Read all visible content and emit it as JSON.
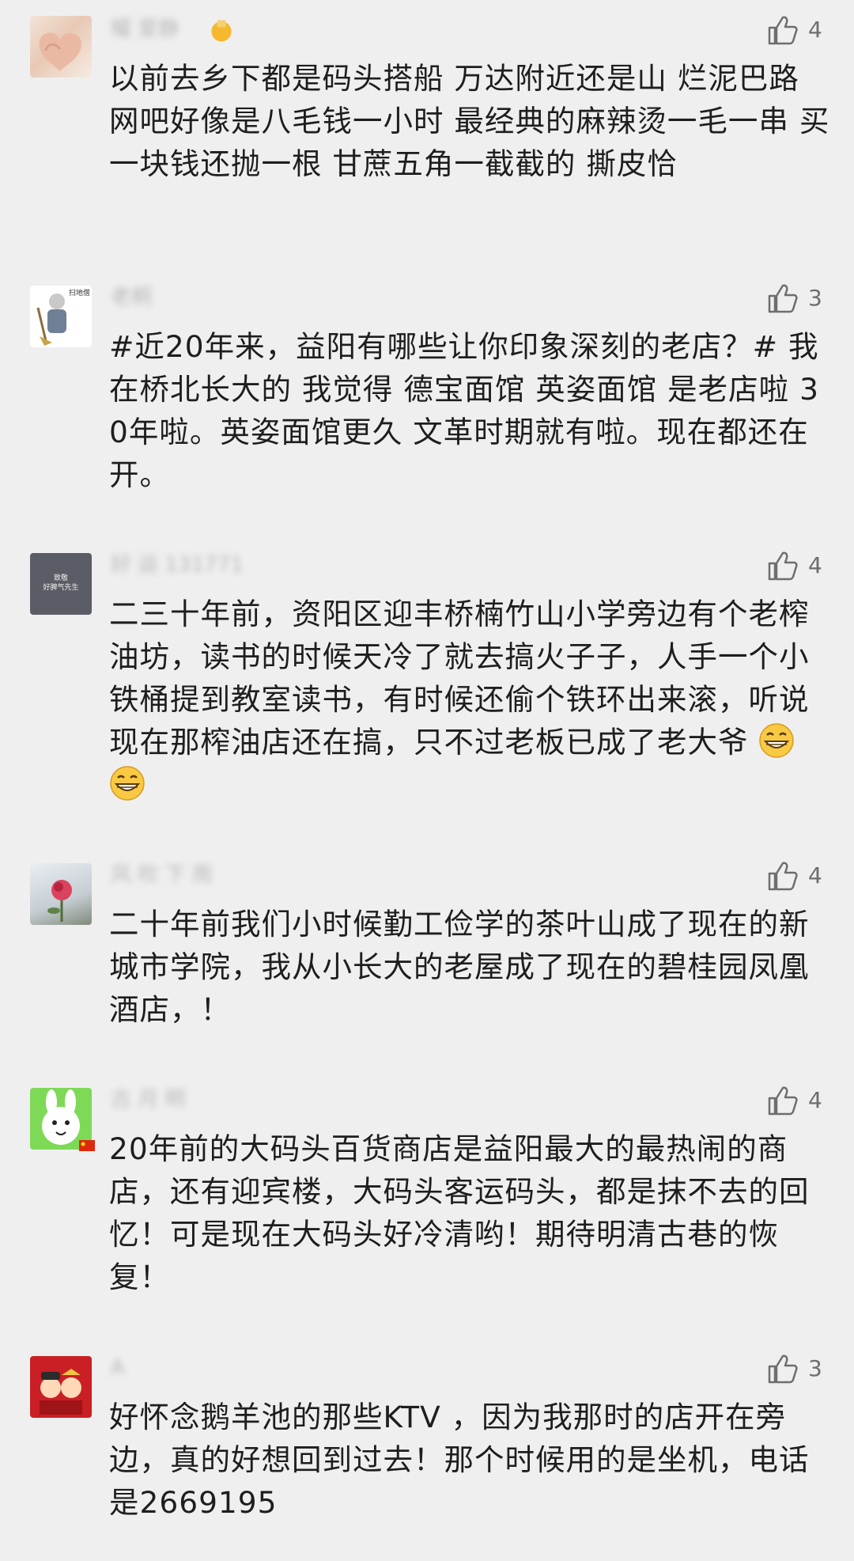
{
  "like_icon": "thumbs-up-outline-icon",
  "colors": {
    "background": "#efefef",
    "text": "#1e1e1e",
    "nickname": "#b9b9b9",
    "like": "#6e6e6e"
  },
  "comments": [
    {
      "nickname": "耀 爱静",
      "likes": "4",
      "text": "以前去乡下都是码头搭船  万达附近还是山  烂泥巴路  网吧好像是八毛钱一小时  最经典的麻辣烫一毛一串  买一块钱还抛一根   甘蔗五角一截截的 撕皮恰"
    },
    {
      "nickname": "老桐",
      "avatar_text": "扫地僧",
      "likes": "3",
      "text": "#近20年来，益阳有哪些让你印象深刻的老店？# 我在桥北长大的 我觉得 德宝面馆 英姿面馆 是老店啦 30年啦。英姿面馆更久 文革时期就有啦。现在都还在开。"
    },
    {
      "nickname": "好 运 131771",
      "avatar_text": "致敬\n好脾气先生",
      "likes": "4",
      "text": "二三十年前，资阳区迎丰桥楠竹山小学旁边有个老榨油坊，读书的时候天冷了就去搞火子子，人手一个小铁桶提到教室读书，有时候还偷个铁环出来滚，听说现在那榨油店还在搞，只不过老板已成了老大爷",
      "emojis": [
        "grin-emoji",
        "grin-emoji"
      ]
    },
    {
      "nickname": "风 吹 下 雨",
      "likes": "4",
      "text": "二十年前我们小时候勤工俭学的茶叶山成了现在的新城市学院，我从小长大的老屋成了现在的碧桂园凤凰酒店，！"
    },
    {
      "nickname": "古 月 明",
      "likes": "4",
      "text": "20年前的大码头百货商店是益阳最大的最热闹的商店，还有迎宾楼，大码头客运码头，都是抹不去的回忆！可是现在大码头好冷清哟！期待明清古巷的恢复！"
    },
    {
      "nickname": "A",
      "likes": "3",
      "text": "好怀念鹅羊池的那些KTV ，因为我那时的店开在旁边，真的好想回到过去！那个时候用的是坐机，电话是2669195"
    }
  ]
}
